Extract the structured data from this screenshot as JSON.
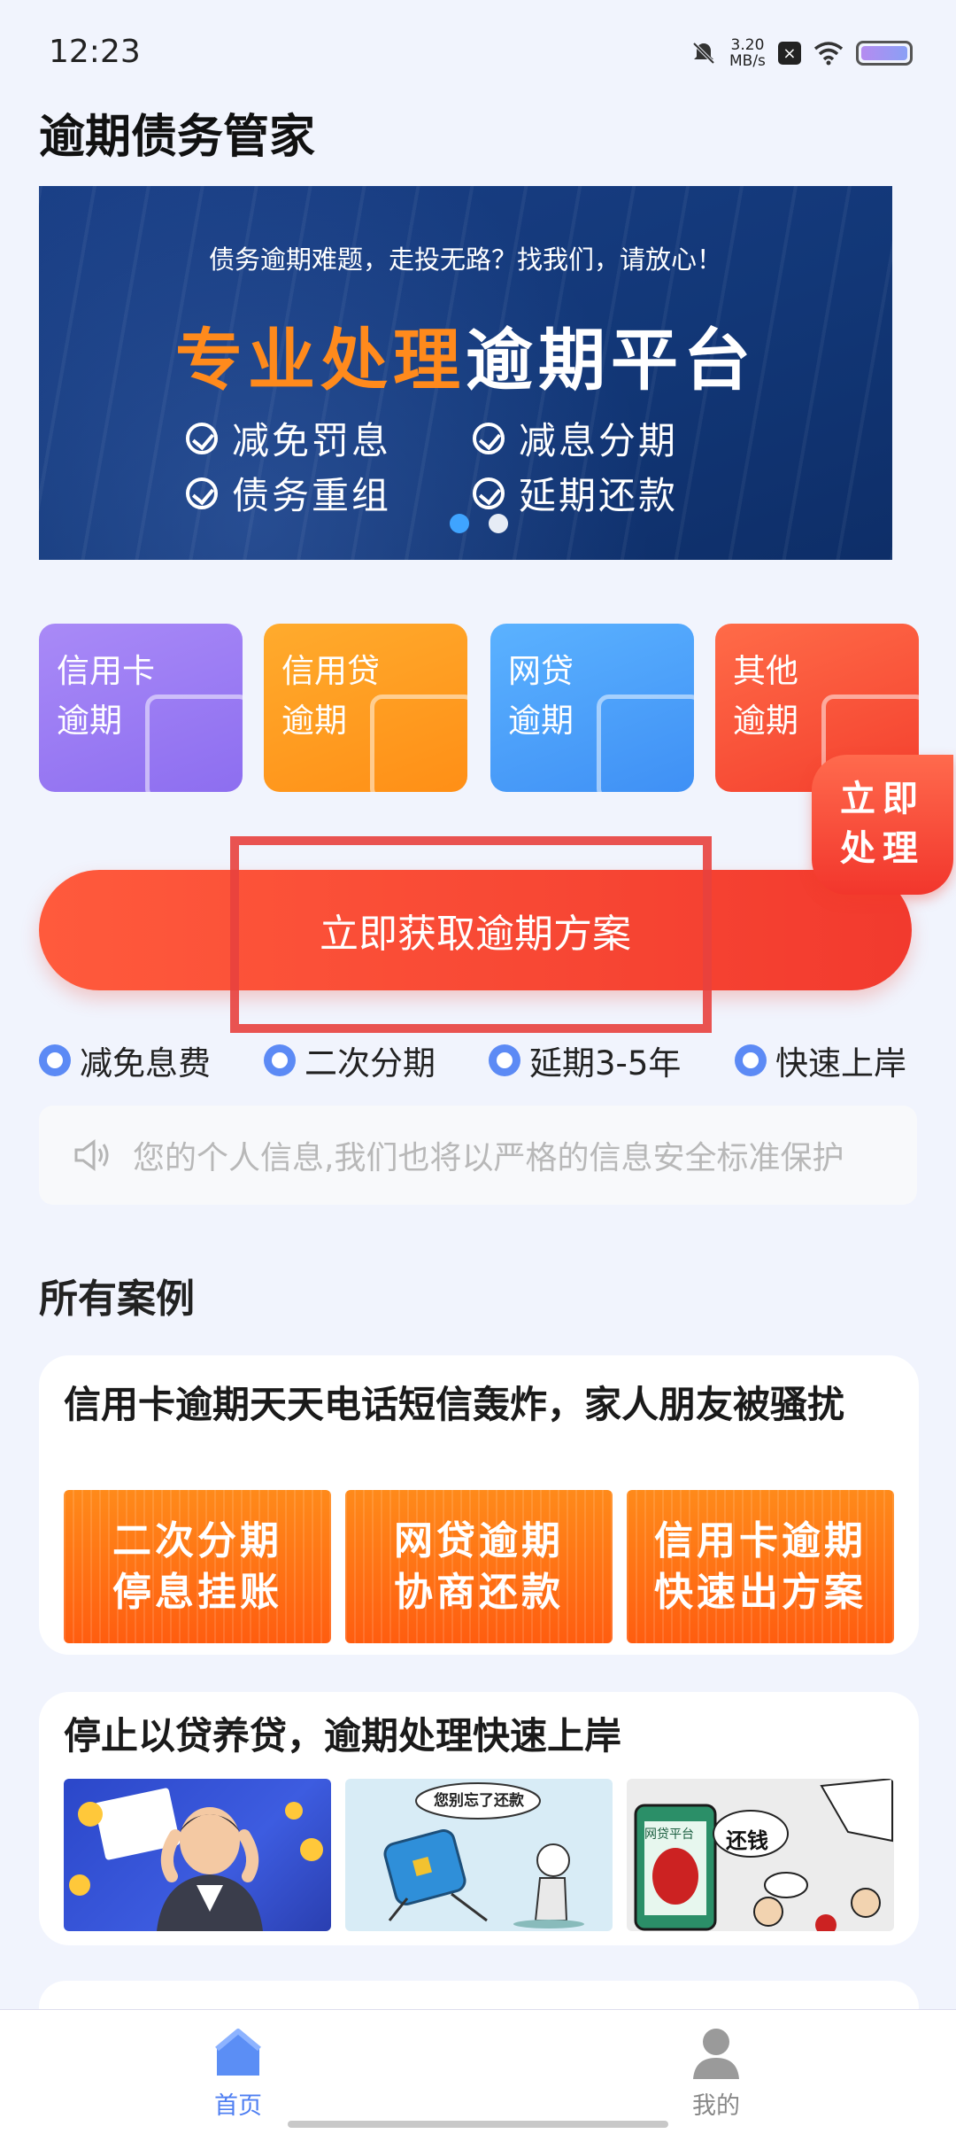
{
  "status_bar": {
    "time": "12:23",
    "speed_value": "3.20",
    "speed_unit": "MB/s"
  },
  "app_title": "逾期债务管家",
  "banner": {
    "subtitle": "债务逾期难题，走投无路？找我们，请放心！",
    "title_orange": "专业处理",
    "title_white": "逾期平台",
    "features": [
      "减免罚息",
      "减息分期",
      "债务重组",
      "延期还款"
    ],
    "active_dot": 0
  },
  "categories": [
    {
      "line1": "信用卡",
      "line2": "逾期",
      "color": "#9b7cf3"
    },
    {
      "line1": "信用贷",
      "line2": "逾期",
      "color": "#ff9d22"
    },
    {
      "line1": "网贷",
      "line2": "逾期",
      "color": "#4aa3f7"
    },
    {
      "line1": "其他",
      "line2": "逾期",
      "color": "#fb5a3e"
    }
  ],
  "float_button": {
    "line1": "立即",
    "line2": "处理"
  },
  "cta_label": "立即获取逾期方案",
  "tags": [
    "减免息费",
    "二次分期",
    "延期3-5年",
    "快速上岸"
  ],
  "notice_text": "您的个人信息,我们也将以严格的信息安全标准保护",
  "section_title": "所有案例",
  "cases": [
    {
      "title": "信用卡逾期天天电话短信轰炸，家人朋友被骚扰",
      "buttons": [
        {
          "line1": "二次分期",
          "line2": "停息挂账"
        },
        {
          "line1": "网贷逾期",
          "line2": "协商还款"
        },
        {
          "line1": "信用卡逾期",
          "line2": "快速出方案"
        }
      ]
    },
    {
      "title": "停止以贷养贷，逾期处理快速上岸",
      "thumb_texts": [
        "您别忘了还款",
        "还钱",
        "网贷平台"
      ]
    }
  ],
  "bottom_nav": [
    {
      "label": "首页",
      "active": true
    },
    {
      "label": "我的",
      "active": false
    }
  ],
  "colors": {
    "accent": "#f23a2e",
    "primary_blue": "#4f7ff2",
    "background": "#f1f4fd"
  }
}
